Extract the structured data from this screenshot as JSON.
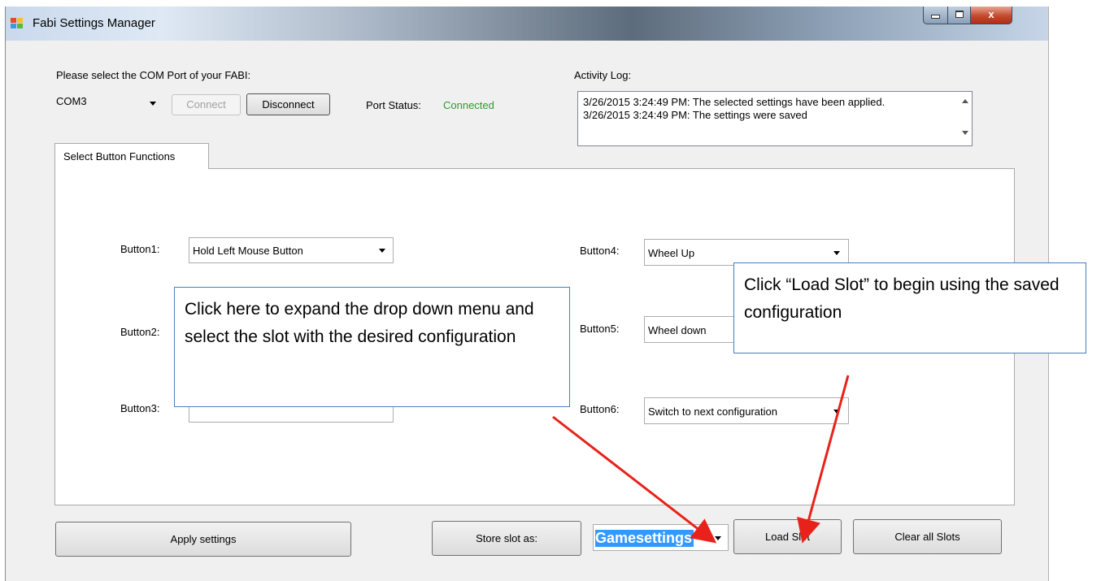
{
  "window": {
    "title": "Fabi Settings Manager",
    "close_glyph": "x"
  },
  "port": {
    "prompt": "Please select the COM Port of your FABI:",
    "selected": "COM3",
    "connect_label": "Connect",
    "disconnect_label": "Disconnect",
    "status_label": "Port Status:",
    "status_value": "Connected"
  },
  "log": {
    "label": "Activity Log:",
    "lines": [
      "3/26/2015 3:24:49 PM: The selected settings have been applied.",
      "3/26/2015 3:24:49 PM: The settings were saved"
    ]
  },
  "tab": {
    "label": "Select Button Functions"
  },
  "buttons": [
    {
      "label": "Button1:",
      "value": "Hold Left Mouse Button"
    },
    {
      "label": "Button2:",
      "value": ""
    },
    {
      "label": "Button3:",
      "value": ""
    },
    {
      "label": "Button4:",
      "value": "Wheel Up"
    },
    {
      "label": "Button5:",
      "value": "Wheel down"
    },
    {
      "label": "Button6:",
      "value": "Switch to next configuration"
    }
  ],
  "bottom": {
    "apply_label": "Apply settings",
    "store_label": "Store slot as:",
    "slot_value": "Gamesettings",
    "load_label": "Load Slot",
    "clear_label": "Clear all Slots"
  },
  "callouts": {
    "left": "Click here to expand the drop down menu and select the slot with the desired configuration",
    "right": "Click “Load Slot” to begin using the saved configuration"
  },
  "colors": {
    "status_green": "#2e9a2e",
    "arrow_red": "#e8221a",
    "callout_border": "#4a7ebb",
    "selection_blue": "#3399ff"
  }
}
